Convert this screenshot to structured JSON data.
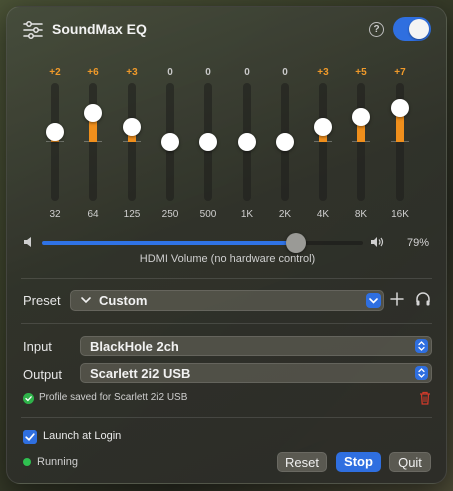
{
  "header": {
    "title": "SoundMax EQ",
    "help_glyph": "?",
    "enabled": true
  },
  "eq": {
    "bands": [
      {
        "freq": "32",
        "gain_label": "+2",
        "gain": 2
      },
      {
        "freq": "64",
        "gain_label": "+6",
        "gain": 6
      },
      {
        "freq": "125",
        "gain_label": "+3",
        "gain": 3
      },
      {
        "freq": "250",
        "gain_label": "0",
        "gain": 0
      },
      {
        "freq": "500",
        "gain_label": "0",
        "gain": 0
      },
      {
        "freq": "1K",
        "gain_label": "0",
        "gain": 0
      },
      {
        "freq": "2K",
        "gain_label": "0",
        "gain": 0
      },
      {
        "freq": "4K",
        "gain_label": "+3",
        "gain": 3
      },
      {
        "freq": "8K",
        "gain_label": "+5",
        "gain": 5
      },
      {
        "freq": "16K",
        "gain_label": "+7",
        "gain": 7
      }
    ],
    "accent_color": "#f08f1c"
  },
  "volume": {
    "percent_label": "79%",
    "level": 0.79,
    "caption": "HDMI Volume (no hardware control)"
  },
  "preset": {
    "label": "Preset",
    "value": "Custom"
  },
  "input": {
    "label": "Input",
    "value": "BlackHole 2ch"
  },
  "output": {
    "label": "Output",
    "value": "Scarlett 2i2 USB"
  },
  "saved_message": "Profile saved for Scarlett 2i2 USB",
  "launch_at_login": {
    "label": "Launch at Login",
    "checked": true
  },
  "status": {
    "text": "Running",
    "color": "#2fc050"
  },
  "buttons": {
    "reset": "Reset",
    "stop": "Stop",
    "quit": "Quit"
  },
  "colors": {
    "accent": "#2f6fe0",
    "warning": "#d03a2a"
  }
}
